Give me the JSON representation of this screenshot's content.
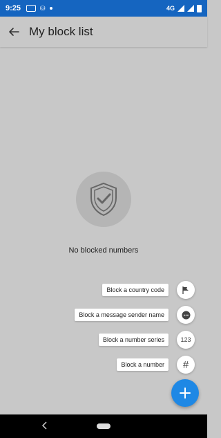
{
  "status_bar": {
    "time": "9:25",
    "network": "4G"
  },
  "app_bar": {
    "title": "My block list",
    "back_icon": "arrow-left-icon"
  },
  "empty_state": {
    "icon": "shield-check-icon",
    "message": "No blocked numbers"
  },
  "fab_menu": {
    "items": [
      {
        "label": "Block a country code",
        "icon": "flag-icon",
        "glyph": ""
      },
      {
        "label": "Block a message sender name",
        "icon": "message-dots-icon",
        "glyph": ""
      },
      {
        "label": "Block a number series",
        "icon": "number-series-icon",
        "glyph": "123"
      },
      {
        "label": "Block a number",
        "icon": "hash-icon",
        "glyph": "#"
      }
    ]
  },
  "colors": {
    "status_bar": "#1565c0",
    "accent": "#1e88e5",
    "overlay_background": "#c8c8c8"
  }
}
